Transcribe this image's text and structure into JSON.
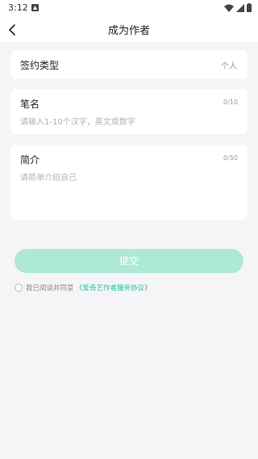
{
  "status_bar": {
    "time": "3:12"
  },
  "header": {
    "title": "成为作者"
  },
  "contract_type": {
    "label": "签约类型",
    "value": "个人"
  },
  "pen_name": {
    "label": "笔名",
    "counter": "0/10",
    "placeholder": "请输入1-10个汉字，英文或数字"
  },
  "intro": {
    "label": "简介",
    "counter": "0/50",
    "placeholder": "请简单介绍自己"
  },
  "submit": {
    "label": "提交"
  },
  "agreement": {
    "prefix": "我已阅读并同意",
    "link": "《爱奇艺作者服务协议》"
  },
  "colors": {
    "accent": "#1fc29c",
    "button_disabled": "#aee9d7",
    "background": "#f5f5f8"
  }
}
